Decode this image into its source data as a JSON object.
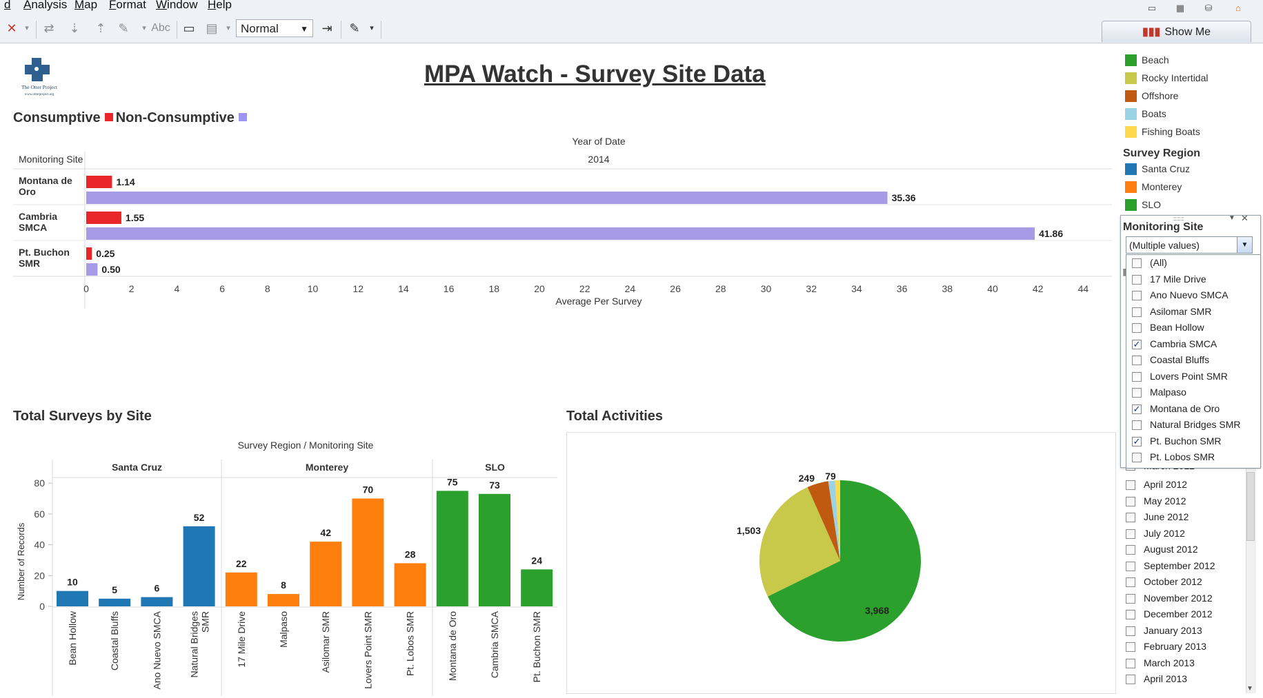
{
  "menu": [
    "Analysis",
    "Map",
    "Format",
    "Window",
    "Help"
  ],
  "toolbar": {
    "style_value": "Normal",
    "abc_label": "Abc",
    "show_me_label": "Show Me"
  },
  "dashboard": {
    "title": "MPA Watch - Survey Site Data",
    "logo_text": "The Otter Project",
    "logo_url_text": "www.otterproject.org"
  },
  "colors": {
    "consumptive": "#e8262a",
    "non_consumptive": "#a89be6",
    "santa_cruz": "#1f77b4",
    "monterey": "#ff7f0e",
    "slo": "#2ca02c",
    "beach": "#2ca02c",
    "rocky_intertidal": "#c8c84a",
    "offshore": "#c05a10",
    "boats": "#9ad3e4",
    "fishing_boats": "#ffd94a"
  },
  "bar_chart": {
    "legend_consumptive": "Consumptive",
    "legend_non_consumptive": "Non-Consumptive",
    "column_header": "Year of Date",
    "year": "2014",
    "row_header": "Monitoring Site",
    "x_axis_title": "Average Per Survey"
  },
  "surveys_chart": {
    "title": "Total Surveys by Site",
    "header": "Survey Region  /  Monitoring Site",
    "y_axis_title": "Number of Records"
  },
  "activities_chart": {
    "title": "Total Activities"
  },
  "legend": {
    "activity_types": [
      {
        "label": "Beach",
        "color": "#2ca02c"
      },
      {
        "label": "Rocky Intertidal",
        "color": "#c8c84a"
      },
      {
        "label": "Offshore",
        "color": "#c05a10"
      },
      {
        "label": "Boats",
        "color": "#9ad3e4"
      },
      {
        "label": "Fishing Boats",
        "color": "#ffd94a"
      }
    ],
    "region_title": "Survey Region",
    "regions": [
      {
        "label": "Santa Cruz",
        "color": "#1f77b4"
      },
      {
        "label": "Monterey",
        "color": "#ff7f0e"
      },
      {
        "label": "SLO",
        "color": "#2ca02c"
      }
    ]
  },
  "filter": {
    "title": "Monitoring Site",
    "combo_value": "(Multiple values)",
    "options": [
      {
        "label": "(All)",
        "checked": false
      },
      {
        "label": "17 Mile Drive",
        "checked": false
      },
      {
        "label": "Ano Nuevo SMCA",
        "checked": false
      },
      {
        "label": "Asilomar SMR",
        "checked": false
      },
      {
        "label": "Bean Hollow",
        "checked": false
      },
      {
        "label": "Cambria SMCA",
        "checked": true
      },
      {
        "label": "Coastal Bluffs",
        "checked": false
      },
      {
        "label": "Lovers Point SMR",
        "checked": false
      },
      {
        "label": "Malpaso",
        "checked": false
      },
      {
        "label": "Montana de Oro",
        "checked": true
      },
      {
        "label": "Natural Bridges SMR",
        "checked": false
      },
      {
        "label": "Pt. Buchon SMR",
        "checked": true
      },
      {
        "label": "Pt. Lobos SMR",
        "checked": false
      }
    ]
  },
  "month_filter": {
    "partial_label": "March 2012",
    "months": [
      "April 2012",
      "May 2012",
      "June 2012",
      "July 2012",
      "August 2012",
      "September 2012",
      "October 2012",
      "November 2012",
      "December 2012",
      "January 2013",
      "February 2013",
      "March 2013",
      "April 2013"
    ]
  },
  "chart_data": [
    {
      "type": "bar",
      "orientation": "horizontal",
      "title": "",
      "xlabel": "Average Per Survey",
      "ylabel": "Monitoring Site",
      "categories": [
        "Montana de Oro",
        "Cambria SMCA",
        "Pt. Buchon SMR"
      ],
      "series": [
        {
          "name": "Consumptive",
          "values": [
            1.14,
            1.55,
            0.25
          ]
        },
        {
          "name": "Non-Consumptive",
          "values": [
            35.36,
            41.86,
            0.5
          ]
        }
      ],
      "value_labels": [
        [
          "1.14",
          "1.55",
          "0.25"
        ],
        [
          "35.36",
          "41.86",
          "0.50"
        ]
      ],
      "xlim": [
        0,
        44
      ],
      "ticks": [
        0,
        2,
        4,
        6,
        8,
        10,
        12,
        14,
        16,
        18,
        20,
        22,
        24,
        26,
        28,
        30,
        32,
        34,
        36,
        38,
        40,
        42,
        44
      ],
      "grid": false
    },
    {
      "type": "bar",
      "title": "Total Surveys by Site",
      "xlabel": "",
      "ylabel": "Number of Records",
      "ylim": [
        0,
        85
      ],
      "yticks": [
        0,
        20,
        40,
        60,
        80
      ],
      "groups": [
        {
          "region": "Santa Cruz",
          "color": "#1f77b4",
          "sites": [
            "Bean Hollow",
            "Coastal Bluffs",
            "Ano Nuevo SMCA",
            "Natural Bridges SMR"
          ],
          "values": [
            10,
            5,
            6,
            52
          ]
        },
        {
          "region": "Monterey",
          "color": "#ff7f0e",
          "sites": [
            "17 Mile Drive",
            "Malpaso",
            "Asilomar SMR",
            "Lovers Point SMR",
            "Pt. Lobos SMR"
          ],
          "values": [
            22,
            8,
            42,
            70,
            28
          ]
        },
        {
          "region": "SLO",
          "color": "#2ca02c",
          "sites": [
            "Montana de Oro",
            "Cambria SMCA",
            "Pt. Buchon SMR"
          ],
          "values": [
            75,
            73,
            24
          ]
        }
      ]
    },
    {
      "type": "pie",
      "title": "Total Activities",
      "categories": [
        "Beach",
        "Rocky Intertidal",
        "Offshore",
        "Boats",
        "Fishing Boats"
      ],
      "values": [
        3968,
        1503,
        249,
        79,
        60
      ],
      "labels": [
        "3,968",
        "1,503",
        "249",
        "79",
        ""
      ],
      "colors": [
        "#2ca02c",
        "#c8c84a",
        "#c05a10",
        "#9ad3e4",
        "#ffd94a"
      ]
    }
  ]
}
